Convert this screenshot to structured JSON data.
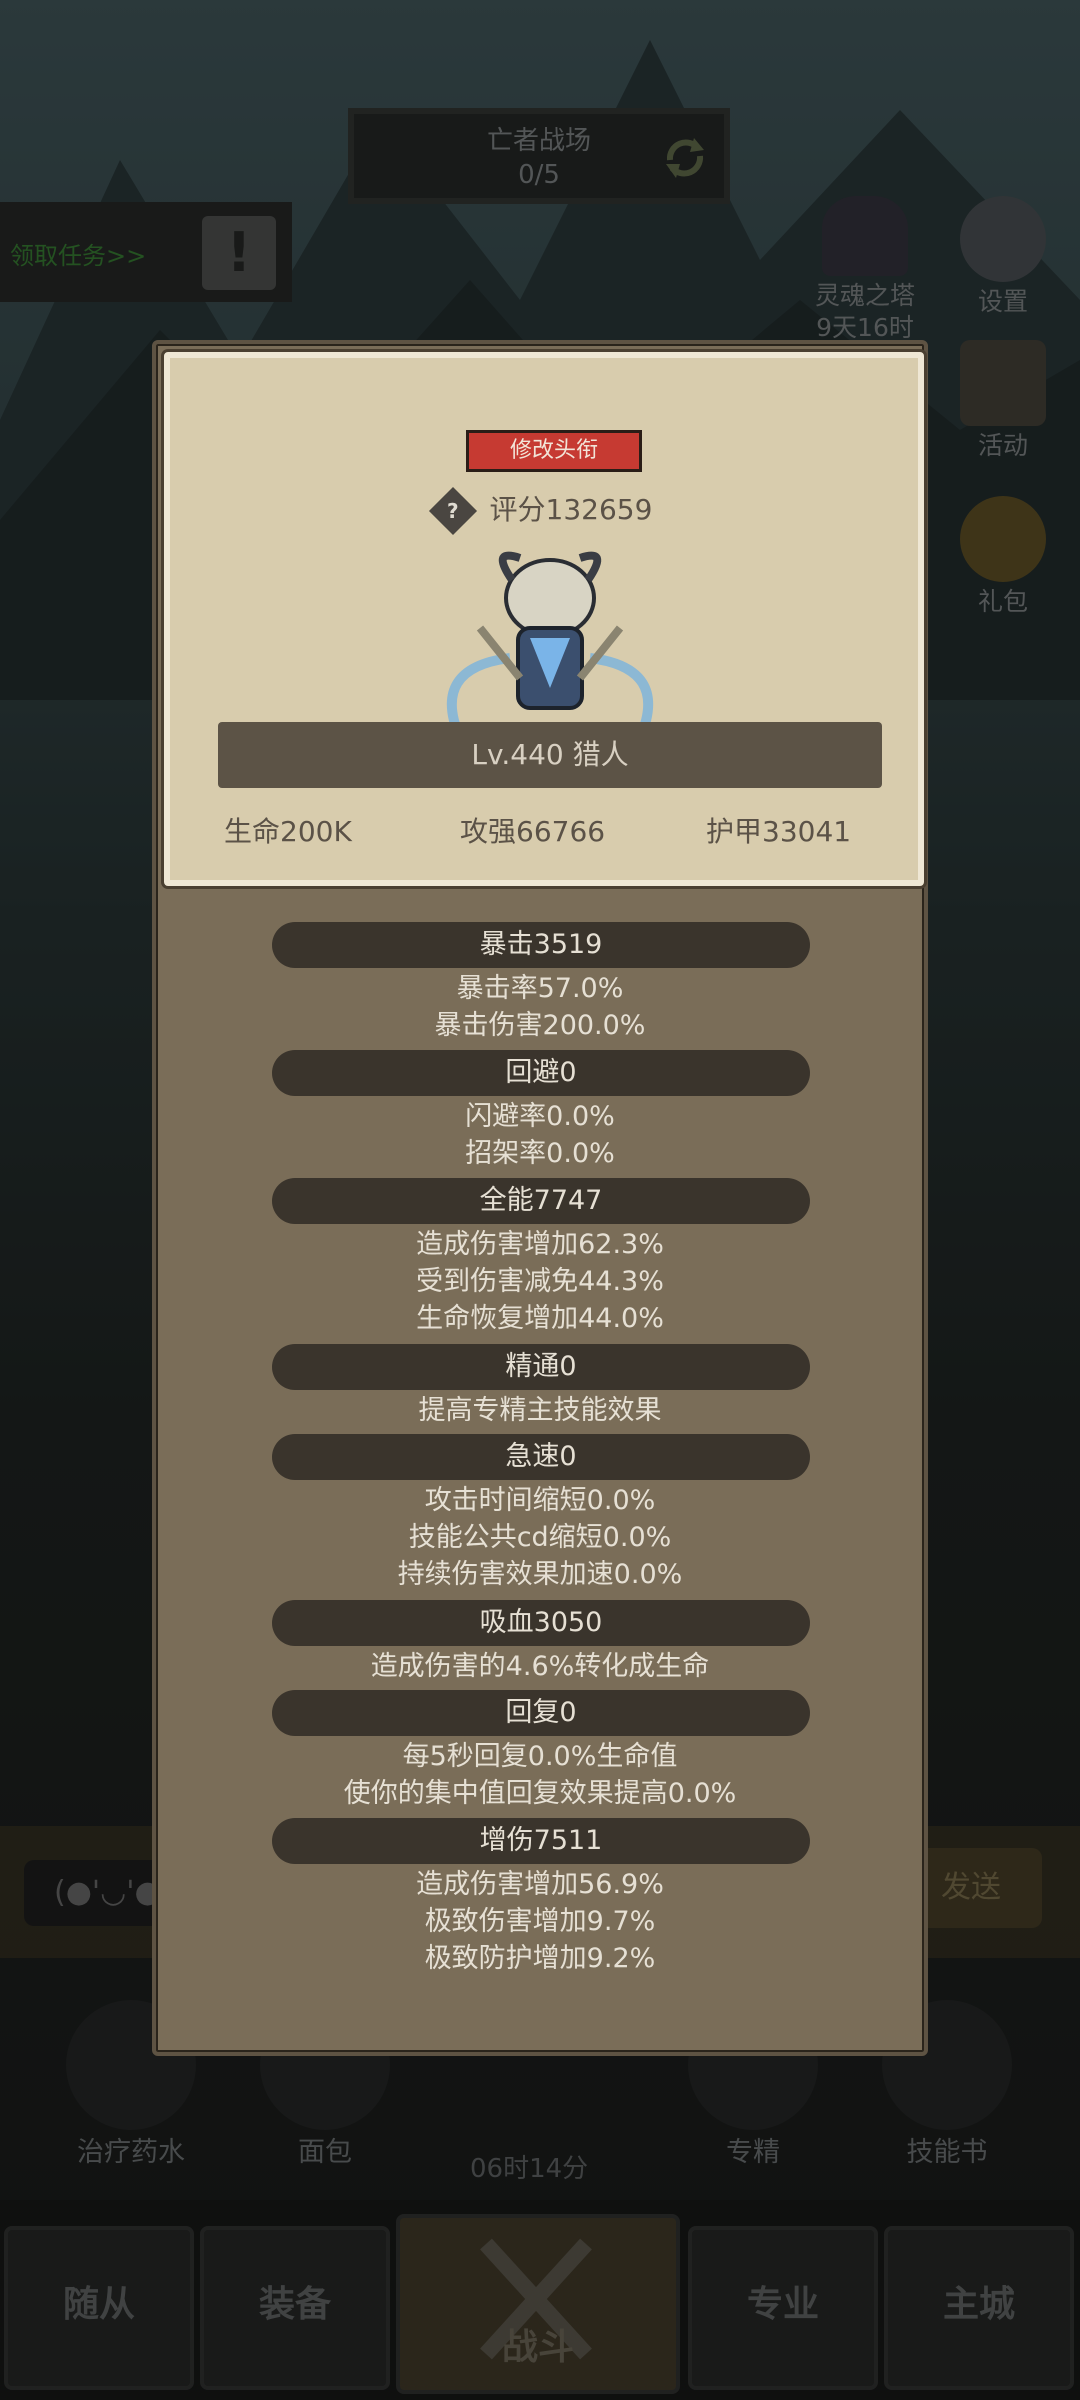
{
  "battle": {
    "title": "亡者战场",
    "progress": "0/5"
  },
  "quest": {
    "label": "领取任务>>"
  },
  "tower": {
    "name": "灵魂之塔",
    "timer": "9天16时"
  },
  "side_buttons": [
    "设置",
    "活动",
    "礼包"
  ],
  "modal": {
    "title_button": "修改头衔",
    "score": "评分132659",
    "help_glyph": "?",
    "level_line": "Lv.440 猎人",
    "hp": "生命200K",
    "attack": "攻强66766",
    "armor": "护甲33041",
    "sections": [
      {
        "header": "暴击3519",
        "lines": [
          "暴击率57.0%",
          "暴击伤害200.0%"
        ]
      },
      {
        "header": "回避0",
        "lines": [
          "闪避率0.0%",
          "招架率0.0%"
        ]
      },
      {
        "header": "全能7747",
        "lines": [
          "造成伤害增加62.3%",
          "受到伤害减免44.3%",
          "生命恢复增加44.0%"
        ]
      },
      {
        "header": "精通0",
        "lines": [
          "提高专精主技能效果"
        ]
      },
      {
        "header": "急速0",
        "lines": [
          "攻击时间缩短0.0%",
          "技能公共cd缩短0.0%",
          "持续伤害效果加速0.0%"
        ]
      },
      {
        "header": "吸血3050",
        "lines": [
          "造成伤害的4.6%转化成生命"
        ]
      },
      {
        "header": "回复0",
        "lines": [
          "每5秒回复0.0%生命值",
          "使你的集中值回复效果提高0.0%"
        ]
      },
      {
        "header": "增伤7511",
        "lines": [
          "造成伤害增加56.9%",
          "极致伤害增加9.7%",
          "极致防护增加9.2%"
        ]
      }
    ]
  },
  "chat": {
    "emote": "(●'◡'●",
    "send": "发送"
  },
  "consumables": [
    "治疗药水",
    "面包",
    "专精",
    "技能书"
  ],
  "timer": "06时14分",
  "nav": [
    "随从",
    "装备",
    "战斗",
    "专业",
    "主城"
  ]
}
